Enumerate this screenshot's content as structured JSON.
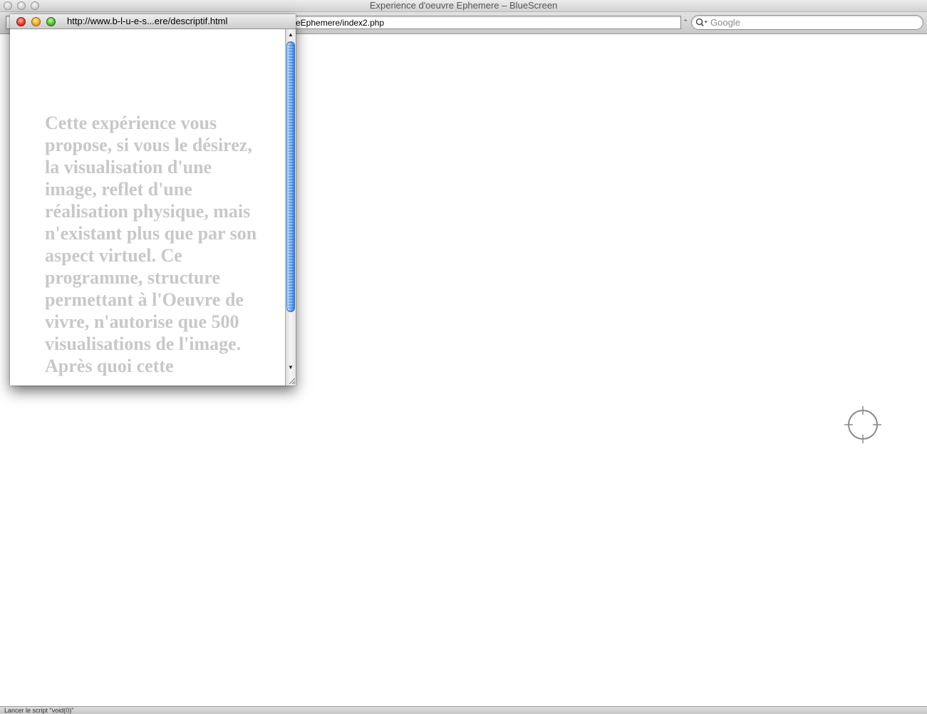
{
  "main_window": {
    "title": "Experience d'oeuvre Ephemere – BlueScreen",
    "address_visible": "eEphemere/index2.php",
    "address_stepper": "⌃",
    "search_placeholder": "Google"
  },
  "popup": {
    "url": "http://www.b-l-u-e-s...ere/descriptif.html",
    "body_text": "Cette expérience vous propose, si vous le désirez, la visualisation d'une image, reflet d'une réalisation physique, mais n'existant plus que par son aspect virtuel. Ce programme, structure permettant à l'Oeuvre de vivre, n'autorise que 500 visualisations de l'image. Après quoi cette"
  },
  "status_bar": {
    "text": "Lancer le script \"void(0)\""
  },
  "cursor": {
    "icon": "crosshair-icon"
  },
  "colors": {
    "popup_text": "#c8c8c8",
    "scroll_thumb": "#5fa0ee"
  }
}
